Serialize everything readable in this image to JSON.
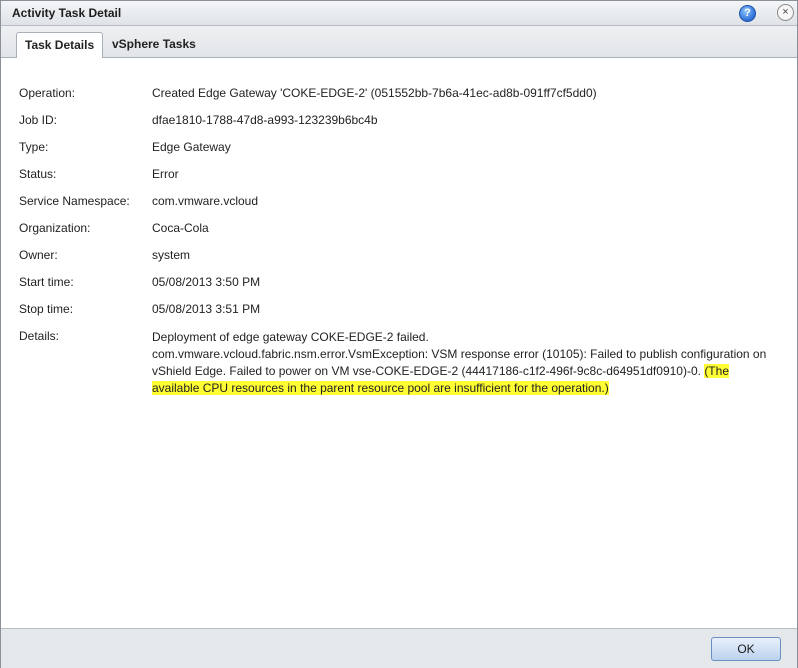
{
  "window": {
    "title": "Activity Task Detail",
    "help_glyph": "?",
    "close_glyph": "×"
  },
  "tabs": [
    {
      "label": "Task Details",
      "active": true
    },
    {
      "label": "vSphere Tasks",
      "active": false
    }
  ],
  "fields": {
    "operation": {
      "label": "Operation:",
      "value": "Created Edge Gateway 'COKE-EDGE-2' (051552bb-7b6a-41ec-ad8b-091ff7cf5dd0)"
    },
    "job_id": {
      "label": "Job ID:",
      "value": "dfae1810-1788-47d8-a993-123239b6bc4b"
    },
    "type": {
      "label": "Type:",
      "value": "Edge Gateway"
    },
    "status": {
      "label": "Status:",
      "value": "Error"
    },
    "service_namespace": {
      "label": "Service Namespace:",
      "value": "com.vmware.vcloud"
    },
    "organization": {
      "label": "Organization:",
      "value": "Coca-Cola"
    },
    "owner": {
      "label": "Owner:",
      "value": "system"
    },
    "start_time": {
      "label": "Start time:",
      "value": "05/08/2013 3:50 PM"
    },
    "stop_time": {
      "label": "Stop time:",
      "value": "05/08/2013 3:51 PM"
    },
    "details": {
      "label": "Details:",
      "line1": "Deployment of edge gateway COKE-EDGE-2 failed.",
      "line2": "com.vmware.vcloud.fabric.nsm.error.VsmException: VSM response error (10105): Failed to publish configuration on vShield Edge. Failed to power on VM vse-COKE-EDGE-2 (44417186-c1f2-496f-9c8c-d64951df0910)-0. ",
      "highlight": "(The available CPU resources in the parent resource pool are insufficient for the operation.)",
      "highlight_color": "#ffff33"
    }
  },
  "footer": {
    "ok_label": "OK"
  }
}
